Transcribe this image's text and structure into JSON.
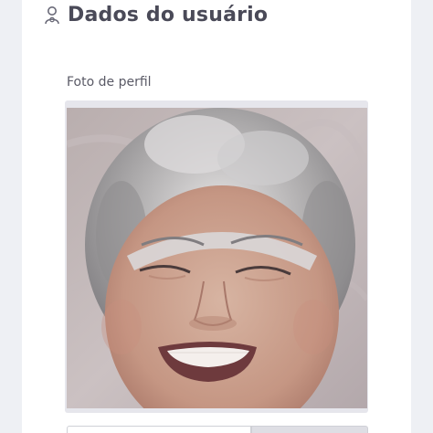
{
  "header": {
    "icon": "user-circle-icon",
    "title": "Dados do usuário"
  },
  "profile_photo": {
    "label": "Foto de perfil",
    "image": "profile-photo-smiling-woman"
  },
  "upload": {
    "input_value": "",
    "button_label": ""
  },
  "colors": {
    "background": "#eef0f4",
    "card": "#ffffff",
    "title_text": "#4a4a58",
    "label_text": "#5a5a66"
  }
}
